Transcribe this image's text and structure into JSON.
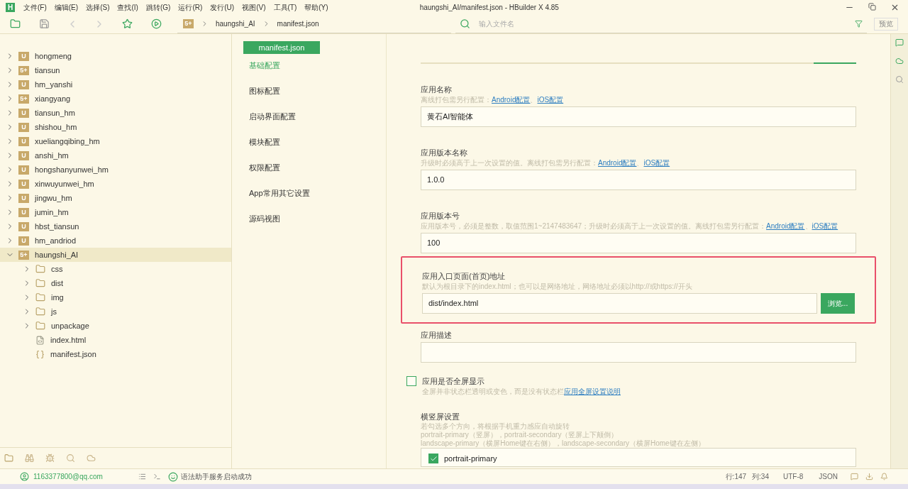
{
  "window": {
    "title": "haungshi_AI/manifest.json - HBuilder X 4.85",
    "logo": "H"
  },
  "menu": [
    "文件(F)",
    "编辑(E)",
    "选择(S)",
    "查找(I)",
    "跳转(G)",
    "运行(R)",
    "发行(U)",
    "视图(V)",
    "工具(T)",
    "帮助(Y)"
  ],
  "breadcrumb_badge": "5+",
  "breadcrumb": [
    "haungshi_AI",
    "manifest.json"
  ],
  "file_search": {
    "placeholder": "输入文件名"
  },
  "preview_button": "预览",
  "tree": [
    {
      "name": "hongmeng",
      "kind": "project",
      "badge": "U",
      "expanded": false,
      "selected": false
    },
    {
      "name": "tiansun",
      "kind": "project",
      "badge": "5+",
      "expanded": false,
      "selected": false
    },
    {
      "name": "hm_yanshi",
      "kind": "project",
      "badge": "U",
      "expanded": false,
      "selected": false
    },
    {
      "name": "xiangyang",
      "kind": "project",
      "badge": "5+",
      "expanded": false,
      "selected": false
    },
    {
      "name": "tiansun_hm",
      "kind": "project",
      "badge": "U",
      "expanded": false,
      "selected": false
    },
    {
      "name": "shishou_hm",
      "kind": "project",
      "badge": "U",
      "expanded": false,
      "selected": false
    },
    {
      "name": "xueliangqibing_hm",
      "kind": "project",
      "badge": "U",
      "expanded": false,
      "selected": false
    },
    {
      "name": "anshi_hm",
      "kind": "project",
      "badge": "U",
      "expanded": false,
      "selected": false
    },
    {
      "name": "hongshanyunwei_hm",
      "kind": "project",
      "badge": "U",
      "expanded": false,
      "selected": false
    },
    {
      "name": "xinwuyunwei_hm",
      "kind": "project",
      "badge": "U",
      "expanded": false,
      "selected": false
    },
    {
      "name": "jingwu_hm",
      "kind": "project",
      "badge": "U",
      "expanded": false,
      "selected": false
    },
    {
      "name": "jumin_hm",
      "kind": "project",
      "badge": "U",
      "expanded": false,
      "selected": false
    },
    {
      "name": "hbst_tiansun",
      "kind": "project",
      "badge": "U",
      "expanded": false,
      "selected": false
    },
    {
      "name": "hm_andriod",
      "kind": "project",
      "badge": "U",
      "expanded": false,
      "selected": false
    },
    {
      "name": "haungshi_AI",
      "kind": "project",
      "badge": "5+",
      "expanded": true,
      "selected": true,
      "children": [
        {
          "name": "css",
          "kind": "folder",
          "expanded": false,
          "selected": false
        },
        {
          "name": "dist",
          "kind": "folder",
          "expanded": false,
          "selected": false
        },
        {
          "name": "img",
          "kind": "folder",
          "expanded": false,
          "selected": false
        },
        {
          "name": "js",
          "kind": "folder",
          "expanded": false,
          "selected": false
        },
        {
          "name": "unpackage",
          "kind": "folder",
          "expanded": false,
          "selected": false
        },
        {
          "name": "index.html",
          "kind": "html",
          "selected": false
        },
        {
          "name": "manifest.json",
          "kind": "json",
          "selected": false
        }
      ]
    }
  ],
  "editor_tab": "manifest.json",
  "sections": [
    {
      "label": "基础配置",
      "selected": true
    },
    {
      "label": "图标配置",
      "selected": false
    },
    {
      "label": "启动界面配置",
      "selected": false
    },
    {
      "label": "模块配置",
      "selected": false
    },
    {
      "label": "权限配置",
      "selected": false
    },
    {
      "label": "App常用其它设置",
      "selected": false
    },
    {
      "label": "源码视图",
      "selected": false
    }
  ],
  "fields": [
    {
      "kind": "text",
      "label": "应用名称",
      "hint": "离线打包需另行配置：",
      "links": [
        "Android配置",
        "iOS配置"
      ],
      "separator": "、",
      "value": "黄石AI智能体"
    },
    {
      "kind": "text",
      "label": "应用版本名称",
      "hint": "升级时必须高于上一次设置的值。离线打包需另行配置：",
      "links": [
        "Android配置",
        "iOS配置"
      ],
      "separator": "、",
      "value": "1.0.0"
    },
    {
      "kind": "text",
      "label": "应用版本号",
      "hint": "应用版本号，必须是整数，取值范围1~2147483647；升级时必须高于上一次设置的值。离线打包需另行配置：",
      "links": [
        "Android配置",
        "iOS配置"
      ],
      "separator": "、",
      "value": "100"
    },
    {
      "kind": "browse",
      "label": "应用入口页面(首页)地址",
      "hint": "默认为根目录下的index.html；也可以是网络地址，网络地址必须以http://或https://开头",
      "value": "dist/index.html",
      "button": "浏览...",
      "highlighted": true
    },
    {
      "kind": "text",
      "label": "应用描述"
    },
    {
      "kind": "checkbox",
      "label": "应用是否全屏显示",
      "checked": false,
      "hint": "全屏并非状态栏透明或变色，而是没有状态栏",
      "links": [
        "应用全屏设置说明"
      ]
    },
    {
      "kind": "options",
      "label": "横竖屏设置",
      "lines": [
        "若勾选多个方向，将根据手机重力感应自动旋转",
        "portrait-primary（竖屏），portrait-secondary（竖屏上下颠倒）",
        "landscape-primary（横屏Home键在右侧），landscape-secondary（横屏Home键在左侧）"
      ],
      "options": [
        {
          "label": "portrait-primary",
          "checked": true
        }
      ]
    }
  ],
  "status_bar": {
    "account": "1163377800@qq.com",
    "message": "语法助手服务启动成功",
    "line": "行:147",
    "column": "列:34",
    "encoding": "UTF-8",
    "language": "JSON"
  }
}
